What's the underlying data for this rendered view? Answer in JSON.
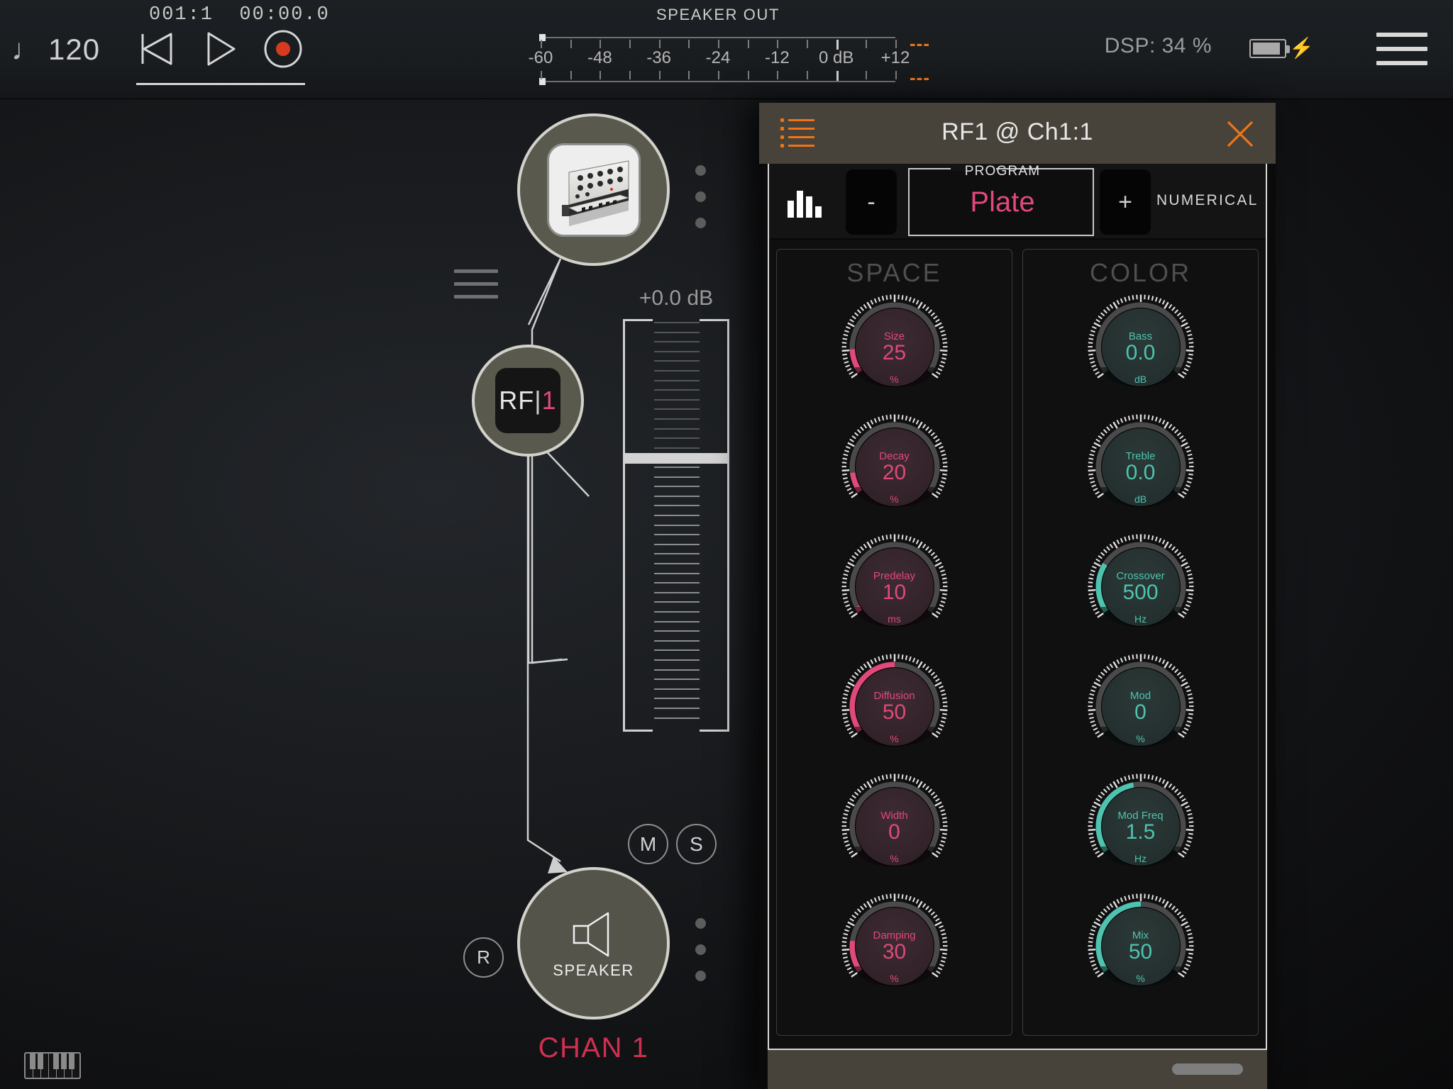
{
  "topbar": {
    "note_glyph": "♩",
    "tempo": "120",
    "timecode_bars": "001:1",
    "timecode_time": "00:00.0",
    "transport": [
      {
        "name": "rewind-button",
        "icon": "rewind-icon"
      },
      {
        "name": "play-button",
        "icon": "play-icon"
      },
      {
        "name": "record-button",
        "icon": "record-icon"
      }
    ],
    "meter": {
      "title": "SPEAKER OUT",
      "tick_labels": [
        "-60",
        "-48",
        "-36",
        "-24",
        "-12",
        "0 dB",
        "+12"
      ],
      "clip_top": "---",
      "clip_bottom": "---"
    },
    "dsp": "DSP: 34 %",
    "battery_icon": "battery-charging-icon",
    "menu_icon": "hamburger-menu-icon"
  },
  "canvas": {
    "synth_node": {
      "name": "synth-instrument-node",
      "icon": "synth-keyboard-icon"
    },
    "rf_node": {
      "label_left": "RF",
      "label_bar": "|",
      "label_right": "1"
    },
    "speaker_node": {
      "label": "SPEAKER",
      "icon": "speaker-icon"
    },
    "fader": {
      "value": "+0.0 dB"
    },
    "mute_button": "M",
    "solo_button": "S",
    "record_arm_button": "R",
    "channel_label": "CHAN 1",
    "keyboard_icon": "piano-keyboard-icon"
  },
  "plugin": {
    "title": "RF1 @ Ch1:1",
    "menu_icon": "list-menu-icon",
    "close_icon": "close-x-icon",
    "analyzer_icon": "bar-chart-icon",
    "minus_label": "-",
    "plus_label": "+",
    "program_caption": "PROGRAM",
    "program_value": "Plate",
    "numerical_label": "NUMERICAL",
    "accent_pink": "#e0497a",
    "accent_teal": "#4fc3b0",
    "accent_orange": "#ef7417",
    "groups": [
      {
        "title": "SPACE",
        "color": "pink",
        "knobs": [
          {
            "name": "Size",
            "value": "25",
            "unit": "%",
            "pct": 0.13
          },
          {
            "name": "Decay",
            "value": "20",
            "unit": "%",
            "pct": 0.11
          },
          {
            "name": "Predelay",
            "value": "10",
            "unit": "ms",
            "pct": 0.03
          },
          {
            "name": "Diffusion",
            "value": "50",
            "unit": "%",
            "pct": 0.5
          },
          {
            "name": "Width",
            "value": "0",
            "unit": "%",
            "pct": 0.0
          },
          {
            "name": "Damping",
            "value": "30",
            "unit": "%",
            "pct": 0.17
          }
        ]
      },
      {
        "title": "COLOR",
        "color": "teal",
        "knobs": [
          {
            "name": "Bass",
            "value": "0.0",
            "unit": "dB",
            "pct": 0.0
          },
          {
            "name": "Treble",
            "value": "0.0",
            "unit": "dB",
            "pct": 0.0
          },
          {
            "name": "Crossover",
            "value": "500",
            "unit": "Hz",
            "pct": 0.27
          },
          {
            "name": "Mod",
            "value": "0",
            "unit": "%",
            "pct": 0.0
          },
          {
            "name": "Mod Freq",
            "value": "1.5",
            "unit": "Hz",
            "pct": 0.46
          },
          {
            "name": "Mix",
            "value": "50",
            "unit": "%",
            "pct": 0.5
          }
        ]
      }
    ]
  }
}
